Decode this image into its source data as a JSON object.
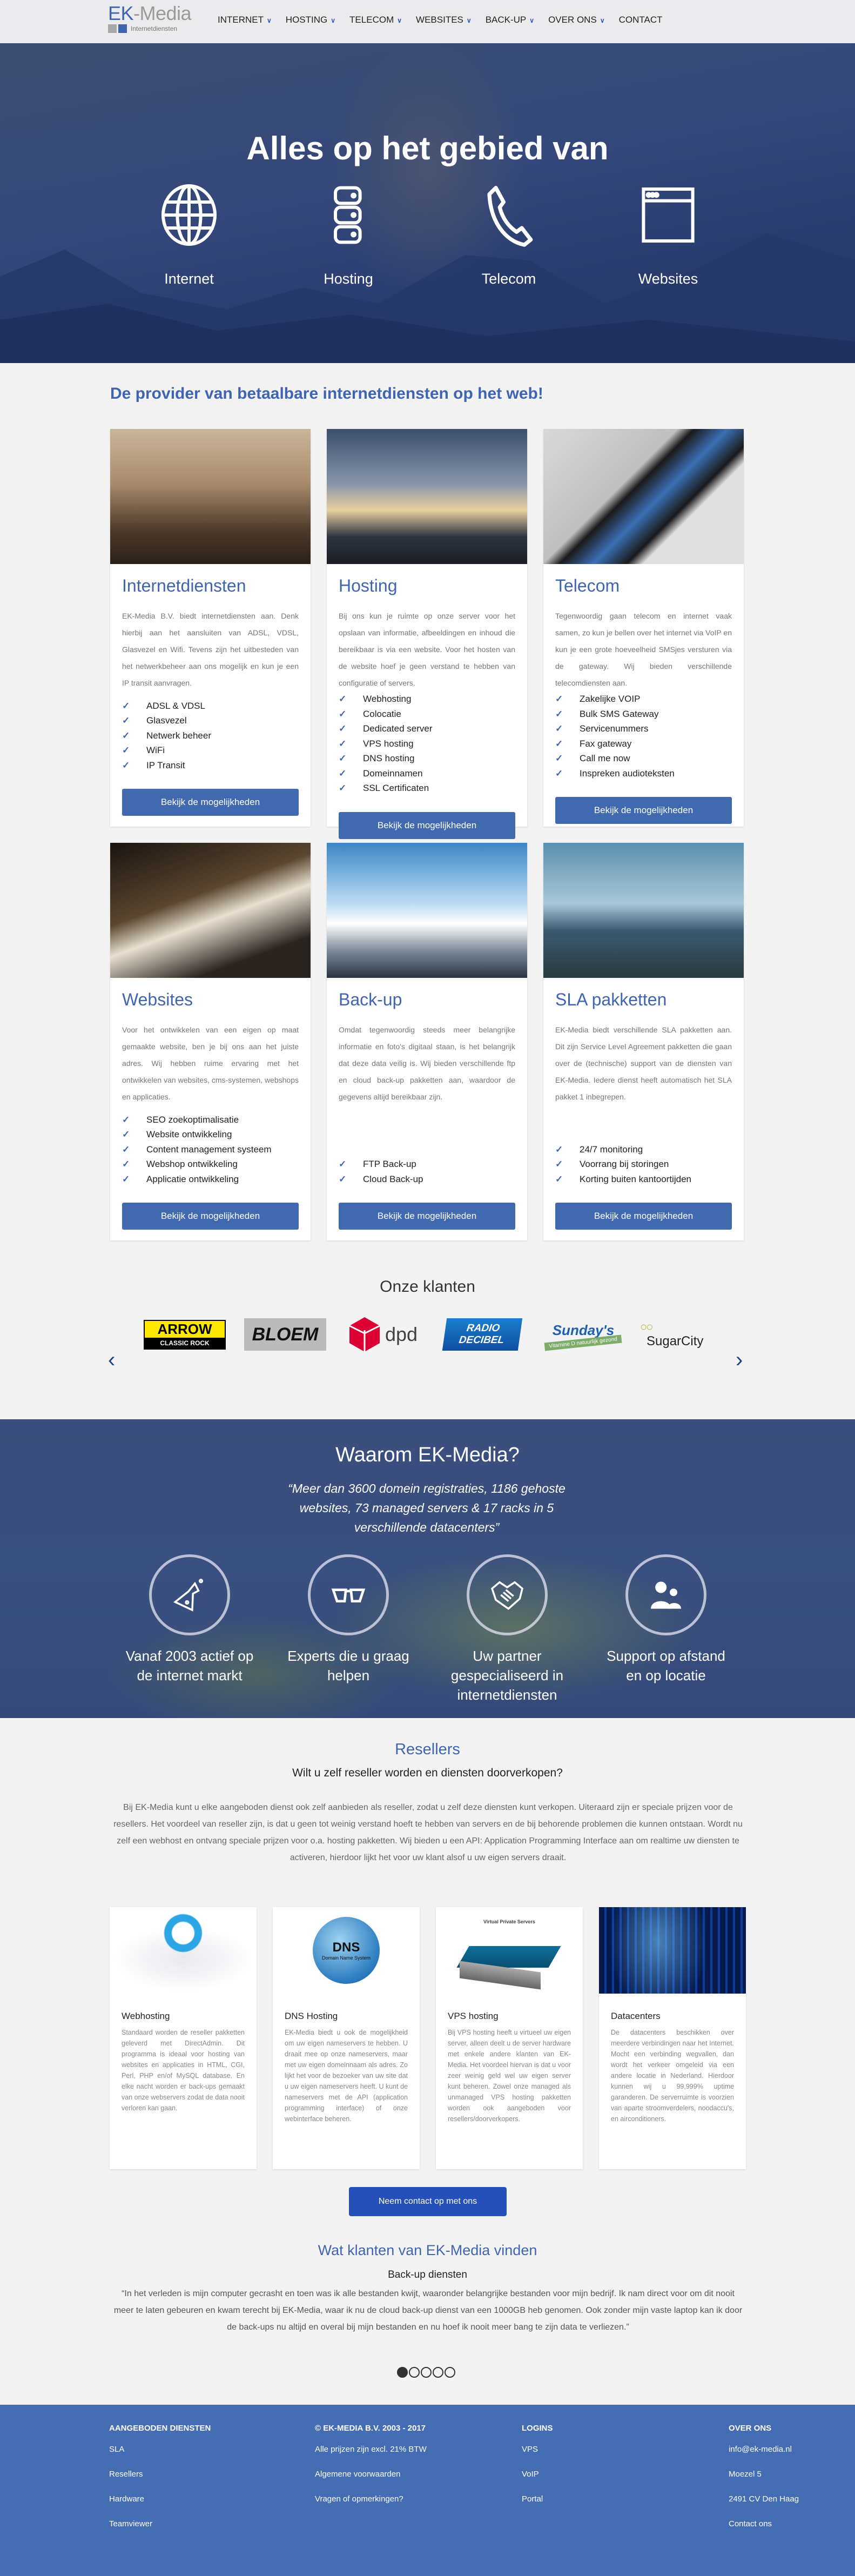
{
  "header": {
    "logo": {
      "ek": "EK",
      "media": "-Media",
      "sub": "Internetdiensten"
    },
    "nav": [
      {
        "label": "INTERNET",
        "dropdown": true
      },
      {
        "label": "HOSTING",
        "dropdown": true
      },
      {
        "label": "TELECOM",
        "dropdown": true
      },
      {
        "label": "WEBSITES",
        "dropdown": true
      },
      {
        "label": "BACK-UP",
        "dropdown": true
      },
      {
        "label": "OVER ONS",
        "dropdown": true
      },
      {
        "label": "CONTACT",
        "dropdown": false
      }
    ]
  },
  "hero": {
    "title": "Alles op het gebied van",
    "items": [
      {
        "label": "Internet",
        "icon": "globe-icon"
      },
      {
        "label": "Hosting",
        "icon": "server-icon"
      },
      {
        "label": "Telecom",
        "icon": "phone-icon"
      },
      {
        "label": "Websites",
        "icon": "browser-window-icon"
      }
    ]
  },
  "tagline": "De provider van betaalbare internetdiensten op het web!",
  "services": {
    "button_label": "Bekijk de mogelijkheden",
    "cards": [
      {
        "title": "Internetdiensten",
        "text": "EK-Media B.V. biedt internetdiensten aan. Denk hierbij aan het aansluiten van ADSL, VDSL, Glasvezel en Wifi. Tevens zijn het uitbesteden van het netwerkbeheer aan ons mogelijk en kun je een IP transit aanvragen.",
        "features": [
          "ADSL & VDSL",
          "Glasvezel",
          "Netwerk beheer",
          "WiFi",
          "IP Transit"
        ]
      },
      {
        "title": "Hosting",
        "text": "Bij ons kun je ruimte op onze server voor het opslaan van informatie, afbeeldingen en inhoud die bereikbaar is via een website. Voor het hosten van de website hoef je geen verstand te hebben van configuratie of servers.",
        "features": [
          "Webhosting",
          "Colocatie",
          "Dedicated server",
          "VPS hosting",
          "DNS hosting",
          "Domeinnamen",
          "SSL Certificaten"
        ]
      },
      {
        "title": "Telecom",
        "text": "Tegenwoordig gaan telecom en internet vaak samen, zo kun je bellen over het internet via VoIP en kun je een grote hoeveelheid SMSjes versturen via de gateway. Wij bieden verschillende telecomdiensten aan.",
        "features": [
          "Zakelijke VOIP",
          "Bulk SMS Gateway",
          "Servicenummers",
          "Fax gateway",
          "Call me now",
          "Inspreken audioteksten"
        ]
      },
      {
        "title": "Websites",
        "text": "Voor het ontwikkelen van een eigen op maat gemaakte website, ben je bij ons aan het juiste adres. Wij hebben ruime ervaring met het ontwikkelen van websites, cms-systemen, webshops en applicaties.",
        "features": [
          "SEO zoekoptimalisatie",
          "Website ontwikkeling",
          "Content management systeem",
          "Webshop ontwikkeling",
          "Applicatie ontwikkeling"
        ]
      },
      {
        "title": "Back-up",
        "text": "Omdat tegenwoordig steeds meer belangrijke informatie en foto's digitaal staan, is het belangrijk dat deze data veilig is. Wij bieden verschillende ftp en cloud back-up pakketten aan, waardoor de gegevens altijd bereikbaar zijn.",
        "features": [
          "FTP Back-up",
          "Cloud Back-up"
        ]
      },
      {
        "title": "SLA pakketten",
        "text": "EK-Media biedt verschillende SLA pakketten aan. Dit zijn Service Level Agreement pakketten die gaan over de (technische) support van de diensten van EK-Media. Iedere dienst heeft automatisch het SLA pakket 1 inbegrepen.",
        "features": [
          "24/7 monitoring",
          "Voorrang bij storingen",
          "Korting buiten kantoortijden"
        ]
      }
    ]
  },
  "clients": {
    "title": "Onze klanten",
    "logos": [
      "ARROW CLASSIC ROCK",
      "BLOEM",
      "dpd",
      "RADIO DECIBEL",
      "Sunday's",
      "SugarCity"
    ]
  },
  "why": {
    "title": "Waarom EK-Media?",
    "quote": "“Meer dan 3600 domein registraties, 1186 gehoste websites, 73 managed servers & 17 racks in 5 verschillende datacenters”",
    "items": [
      {
        "label": "Vanaf 2003 actief op de internet markt",
        "icon": "flask-icon"
      },
      {
        "label": "Experts die u graag helpen",
        "icon": "glasses-icon"
      },
      {
        "label": "Uw partner gespecialiseerd in internetdiensten",
        "icon": "handshake-icon"
      },
      {
        "label": "Support op afstand en op locatie",
        "icon": "support-agent-icon"
      }
    ]
  },
  "resellers": {
    "title": "Resellers",
    "subtitle": "Wilt u zelf reseller worden en diensten doorverkopen?",
    "text": "Bij EK-Media kunt u elke aangeboden dienst ook zelf aanbieden als reseller, zodat u zelf deze diensten kunt verkopen. Uiteraard zijn er speciale prijzen voor de resellers. Het voordeel van reseller zijn, is dat u geen tot weinig verstand hoeft te hebben van servers en de bij behorende problemen die kunnen ontstaan. Wordt nu zelf een webhost en ontvang speciale prijzen voor o.a. hosting pakketten. Wij bieden u een API: Application Programming Interface aan om realtime uw diensten te activeren, hierdoor lijkt het voor uw klant alsof u uw eigen servers draait.",
    "cards": [
      {
        "title": "Webhosting",
        "text": "Standaard worden de reseller pakketten geleverd met DirectAdmin. Dit programma is ideaal voor hosting van websites en applicaties in HTML, CGI, Perl, PHP en/of MySQL database. En elke nacht worden er back-ups gemaakt van onze webservers zodat de data nooit verloren kan gaan."
      },
      {
        "title": "DNS Hosting",
        "text": "EK-Media biedt u ook de mogelijkheid om uw eigen nameservers te hebben. U draait mee op onze nameservers, maar met uw eigen domeinnaam als adres. Zo lijkt het voor de bezoeker van uw site dat u uw eigen nameservers heeft. U kunt de nameservers met de API (application programming interface) of onze webinterface beheren.",
        "image_text": [
          "DNS",
          "Domain Name System"
        ]
      },
      {
        "title": "VPS hosting",
        "text": "Bij VPS hosting heeft u virtueel uw eigen server, alleen deelt u de server hardware met enkele andere klanten van EK-Media. Het voordeel hiervan is dat u voor zeer weinig geld wel uw eigen server kunt beheren. Zowel onze managed als unmanaged VPS hosting pakketten worden ook aangeboden voor resellers/doorverkopers.",
        "image_text": [
          "Virtual Private Servers"
        ]
      },
      {
        "title": "Datacenters",
        "text": "De datacenters beschikken over meerdere verbindingen naar het Internet. Mocht een verbinding wegvallen, dan wordt het verkeer omgeleid via een andere locatie in Nederland. Hierdoor kunnen wij u 99,999% uptime garanderen. De serverruimte is voorzien van aparte stroomverdelers, noodaccu's, en airconditioners."
      }
    ],
    "contact_button": "Neem contact op met ons"
  },
  "testimonials": {
    "title": "Wat klanten van EK-Media vinden",
    "subtitle": "Back-up diensten",
    "quote": "“In het verleden is mijn computer gecrasht en toen was ik alle bestanden kwijt, waaronder belangrijke bestanden voor mijn bedrijf. Ik nam direct voor om dit nooit meer te laten gebeuren en kwam terecht bij EK-Media, waar ik nu de cloud back-up dienst van een 1000GB heb genomen. Ook zonder mijn vaste laptop kan ik door de back-ups nu altijd en overal bij mijn bestanden en nu hoef ik nooit meer bang te zijn data te verliezen.”",
    "slides": 5,
    "active_slide": 1
  },
  "footer": {
    "columns": [
      {
        "title": "AANGEBODEN DIENSTEN",
        "items": [
          "SLA",
          "Resellers",
          "Hardware",
          "Teamviewer"
        ]
      },
      {
        "title": "© EK-MEDIA B.V. 2003 - 2017",
        "items": [
          "Alle prijzen zijn excl. 21% BTW",
          "Algemene voorwaarden",
          "Vragen of opmerkingen?"
        ]
      },
      {
        "title": "LOGINS",
        "items": [
          "VPS",
          "VoIP",
          "Portal"
        ]
      },
      {
        "title": "OVER ONS",
        "items": [
          "info@ek-media.nl",
          "Moezel 5",
          "2491 CV Den Haag",
          "Contact ons"
        ]
      }
    ]
  },
  "colors": {
    "accent": "#3f64b0",
    "button": "#4169b0",
    "contact_button": "#2450b8",
    "footer": "#446db4",
    "hero_overlay": "#2f4476"
  }
}
